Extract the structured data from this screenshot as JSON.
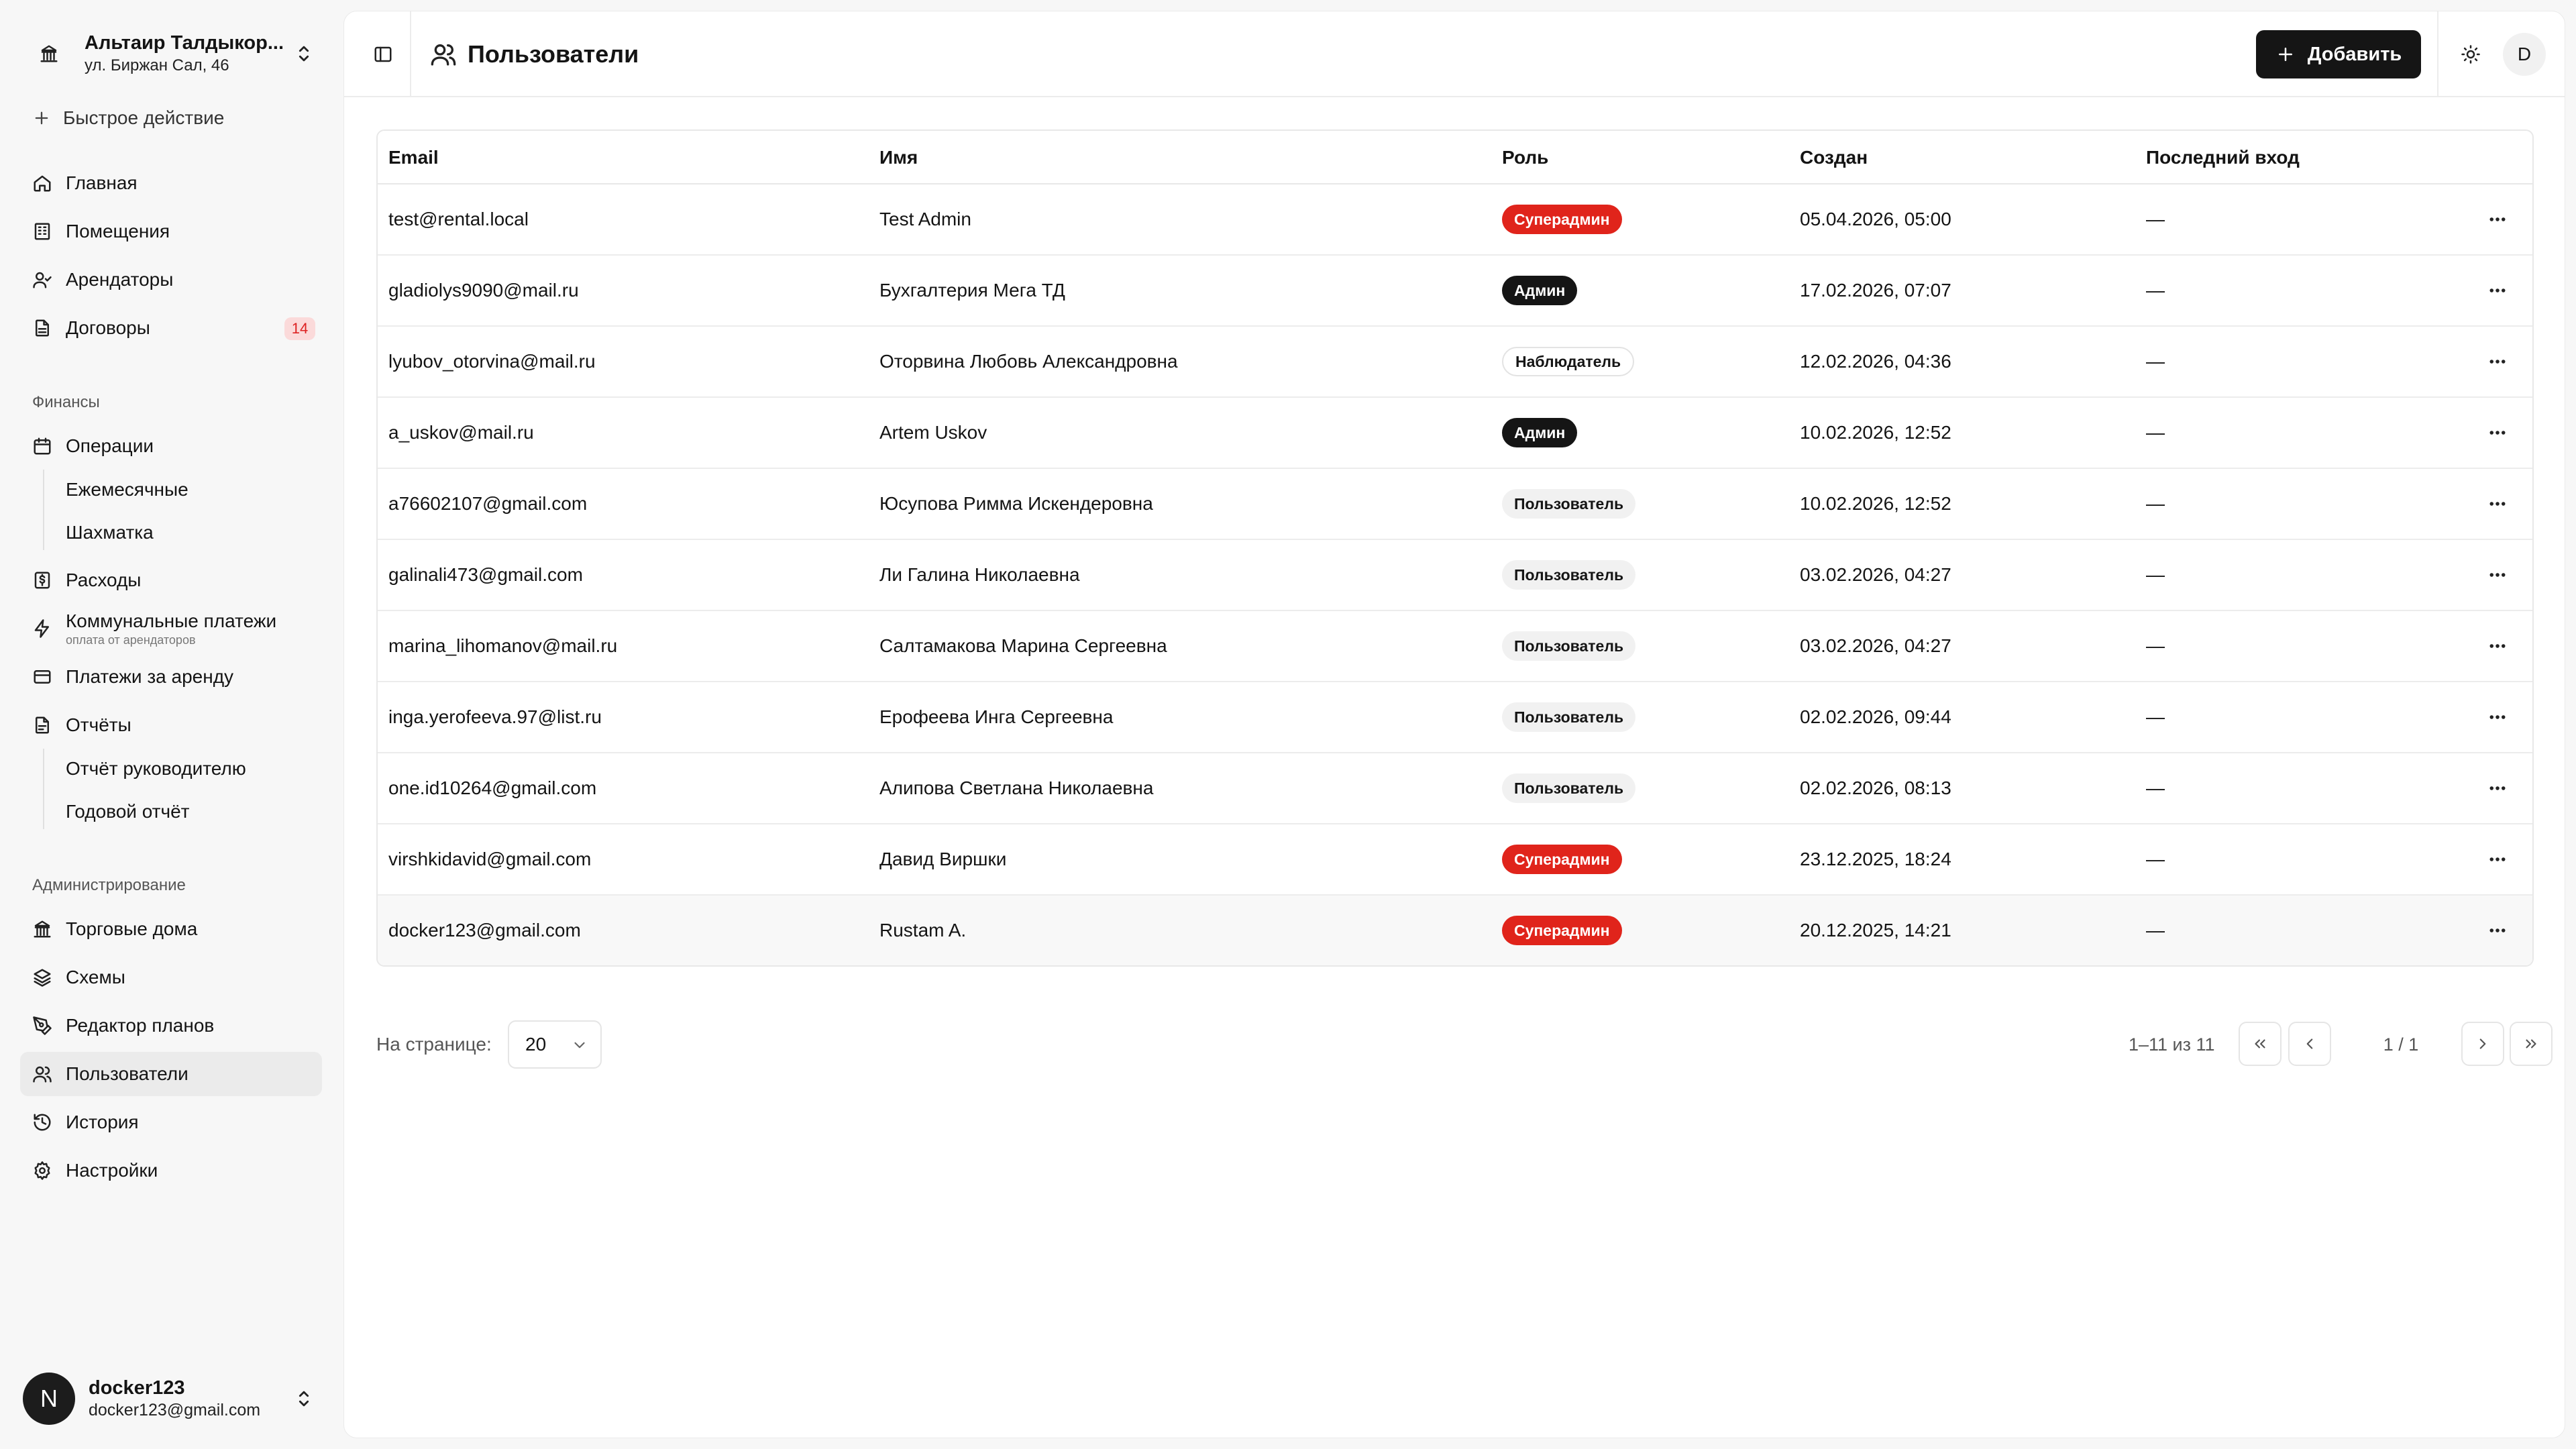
{
  "org": {
    "name": "Альтаир Талдыкор...",
    "address": "ул. Биржан Сал, 46"
  },
  "quick_action": "Быстрое действие",
  "nav": {
    "home": "Главная",
    "premises": "Помещения",
    "tenants": "Арендаторы",
    "contracts": "Договоры",
    "contracts_badge": "14",
    "finance_label": "Финансы",
    "operations": "Операции",
    "monthly": "Ежемесячные",
    "chess": "Шахматка",
    "expenses": "Расходы",
    "utilities": "Коммунальные платежи",
    "utilities_sub": "оплата от арендаторов",
    "rent_payments": "Платежи за аренду",
    "reports": "Отчёты",
    "manager_report": "Отчёт руководителю",
    "annual_report": "Годовой отчёт",
    "admin_label": "Администрирование",
    "malls": "Торговые дома",
    "schemes": "Схемы",
    "plan_editor": "Редактор планов",
    "users": "Пользователи",
    "history": "История",
    "settings": "Настройки"
  },
  "current_user": {
    "initial": "N",
    "name": "docker123",
    "email": "docker123@gmail.com"
  },
  "header": {
    "title": "Пользователи",
    "add_label": "Добавить",
    "avatar": "D"
  },
  "table": {
    "columns": [
      "Email",
      "Имя",
      "Роль",
      "Создан",
      "Последний вход"
    ],
    "rows": [
      {
        "email": "test@rental.local",
        "name": "Test Admin",
        "role": "Суперадмин",
        "role_kind": "superadmin",
        "created": "05.04.2026, 05:00",
        "last_login": "—"
      },
      {
        "email": "gladiolys9090@mail.ru",
        "name": "Бухгалтерия Мега ТД",
        "role": "Админ",
        "role_kind": "admin",
        "created": "17.02.2026, 07:07",
        "last_login": "—"
      },
      {
        "email": "lyubov_otorvina@mail.ru",
        "name": "Оторвина Любовь Александровна",
        "role": "Наблюдатель",
        "role_kind": "viewer",
        "created": "12.02.2026, 04:36",
        "last_login": "—"
      },
      {
        "email": "a_uskov@mail.ru",
        "name": "Artem Uskov",
        "role": "Админ",
        "role_kind": "admin",
        "created": "10.02.2026, 12:52",
        "last_login": "—"
      },
      {
        "email": "a76602107@gmail.com",
        "name": "Юсупова Римма Искендеровна",
        "role": "Пользователь",
        "role_kind": "user",
        "created": "10.02.2026, 12:52",
        "last_login": "—"
      },
      {
        "email": "galinali473@gmail.com",
        "name": "Ли Галина Николаевна",
        "role": "Пользователь",
        "role_kind": "user",
        "created": "03.02.2026, 04:27",
        "last_login": "—"
      },
      {
        "email": "marina_lihomanov@mail.ru",
        "name": "Салтамакова Марина Сергеевна",
        "role": "Пользователь",
        "role_kind": "user",
        "created": "03.02.2026, 04:27",
        "last_login": "—"
      },
      {
        "email": "inga.yerofeeva.97@list.ru",
        "name": "Ерофеева Инга Сергеевна",
        "role": "Пользователь",
        "role_kind": "user",
        "created": "02.02.2026, 09:44",
        "last_login": "—"
      },
      {
        "email": "one.id10264@gmail.com",
        "name": "Алипова Светлана Николаевна",
        "role": "Пользователь",
        "role_kind": "user",
        "created": "02.02.2026, 08:13",
        "last_login": "—"
      },
      {
        "email": "virshkidavid@gmail.com",
        "name": "Давид Виршки",
        "role": "Суперадмин",
        "role_kind": "superadmin",
        "created": "23.12.2025, 18:24",
        "last_login": "—"
      },
      {
        "email": "docker123@gmail.com",
        "name": "Rustam A.",
        "role": "Суперадмин",
        "role_kind": "superadmin",
        "created": "20.12.2025, 14:21",
        "last_login": "—"
      }
    ]
  },
  "pagination": {
    "per_page_label": "На странице:",
    "per_page": "20",
    "range": "1–11 из 11",
    "page_info": "1 / 1"
  },
  "colors": {
    "superadmin": "#e0241b",
    "admin": "#151515",
    "badge": "#fbdada",
    "primary_button": "#151515"
  }
}
